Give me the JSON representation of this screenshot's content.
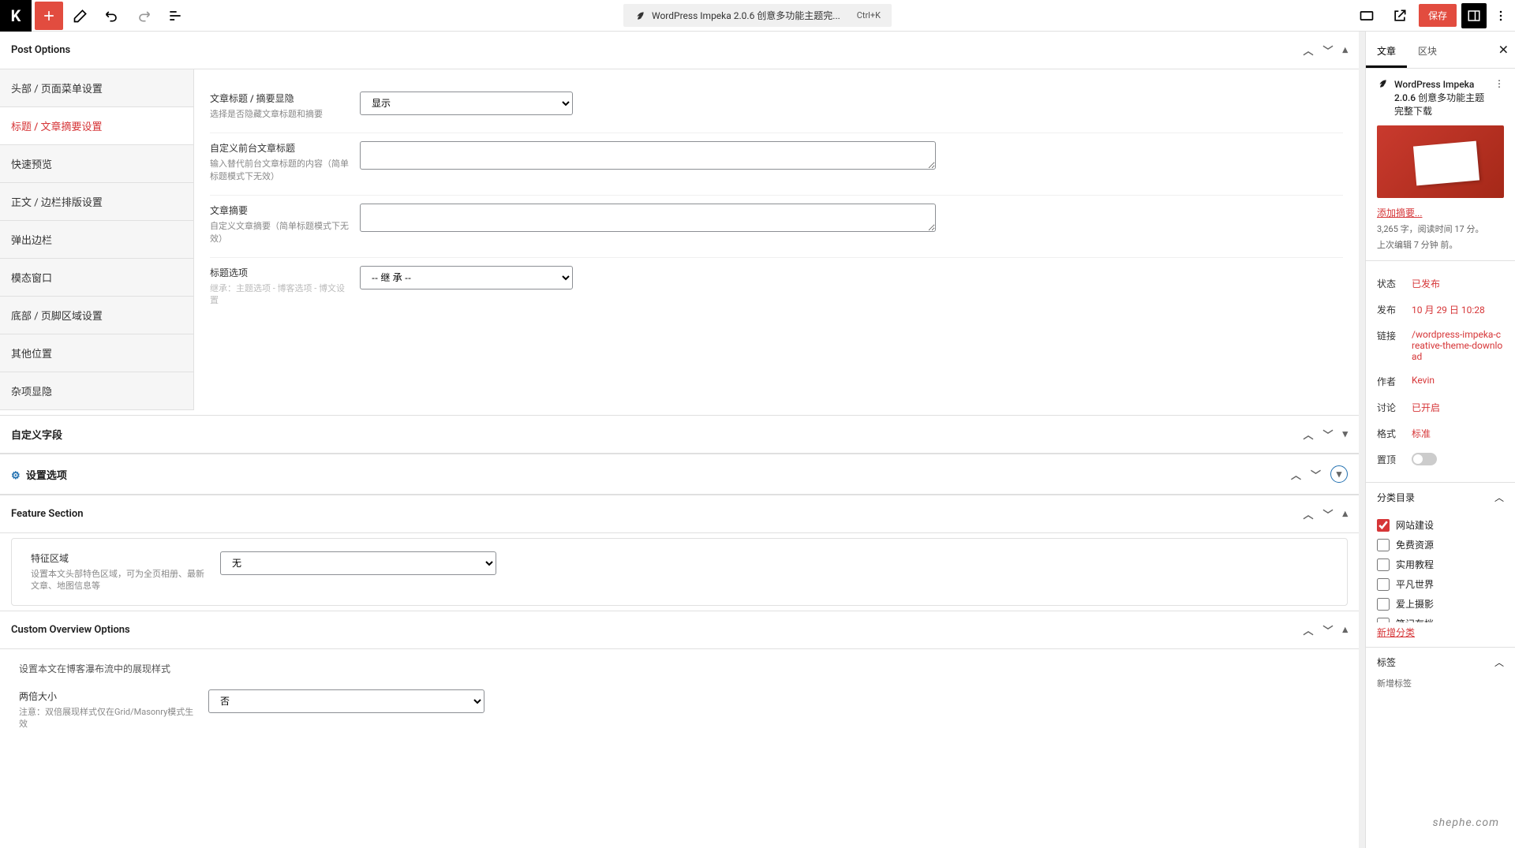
{
  "toolbar": {
    "doc_title": "WordPress Impeka 2.0.6 创意多功能主题完...",
    "shortcut": "Ctrl+K",
    "save_label": "保存"
  },
  "post_options": {
    "panel_title": "Post Options",
    "tabs": [
      "头部 / 页面菜单设置",
      "标题 / 文章摘要设置",
      "快速预览",
      "正文 / 边栏排版设置",
      "弹出边栏",
      "模态窗口",
      "底部 / 页脚区域设置",
      "其他位置",
      "杂项显隐"
    ],
    "fields": {
      "title_vis_label": "文章标题 / 摘要显隐",
      "title_vis_help": "选择是否隐藏文章标题和摘要",
      "title_vis_value": "显示",
      "custom_title_label": "自定义前台文章标题",
      "custom_title_help": "输入替代前台文章标题的内容（简单标题模式下无效）",
      "excerpt_label": "文章摘要",
      "excerpt_help": "自定义文章摘要（简单标题模式下无效）",
      "title_opt_label": "标题选项",
      "title_opt_help": "继承：主题选项 - 博客选项 - 博文设置",
      "title_opt_value": "-- 继 承 --"
    }
  },
  "custom_fields": {
    "title": "自定义字段"
  },
  "settings_options": {
    "title": "设置选项"
  },
  "feature_section": {
    "title": "Feature Section",
    "field_label": "特征区域",
    "field_help": "设置本文头部特色区域，可为全页相册、最新文章、地图信息等",
    "field_value": "无"
  },
  "custom_overview": {
    "title": "Custom Overview Options",
    "desc": "设置本文在博客瀑布流中的展现样式",
    "double_label": "两倍大小",
    "double_help": "注意：双倍展现样式仅在Grid/Masonry模式生效",
    "double_value": "否"
  },
  "sidebar": {
    "tab_post": "文章",
    "tab_block": "区块",
    "post_title": "WordPress Impeka 2.0.6 创意多功能主题完整下载",
    "add_excerpt": "添加摘要...",
    "words_line": "3,265 字，阅读时间 17 分。",
    "last_edit": "上次编辑 7 分钟 前。",
    "rows": {
      "status_k": "状态",
      "status_v": "已发布",
      "publish_k": "发布",
      "publish_v": "10 月 29 日 10:28",
      "link_k": "链接",
      "link_v": "/wordpress-impeka-creative-theme-download",
      "author_k": "作者",
      "author_v": "Kevin",
      "discuss_k": "讨论",
      "discuss_v": "已开启",
      "format_k": "格式",
      "format_v": "标准",
      "sticky_k": "置顶"
    },
    "categories_title": "分类目录",
    "categories": [
      {
        "label": "网站建设",
        "checked": true
      },
      {
        "label": "免费资源",
        "checked": false
      },
      {
        "label": "实用教程",
        "checked": false
      },
      {
        "label": "平凡世界",
        "checked": false
      },
      {
        "label": "爱上摄影",
        "checked": false
      },
      {
        "label": "笔记存档",
        "checked": false
      }
    ],
    "new_category": "新增分类",
    "tags_title": "标签",
    "new_tag": "新增标签"
  },
  "watermark": "shephe.com"
}
